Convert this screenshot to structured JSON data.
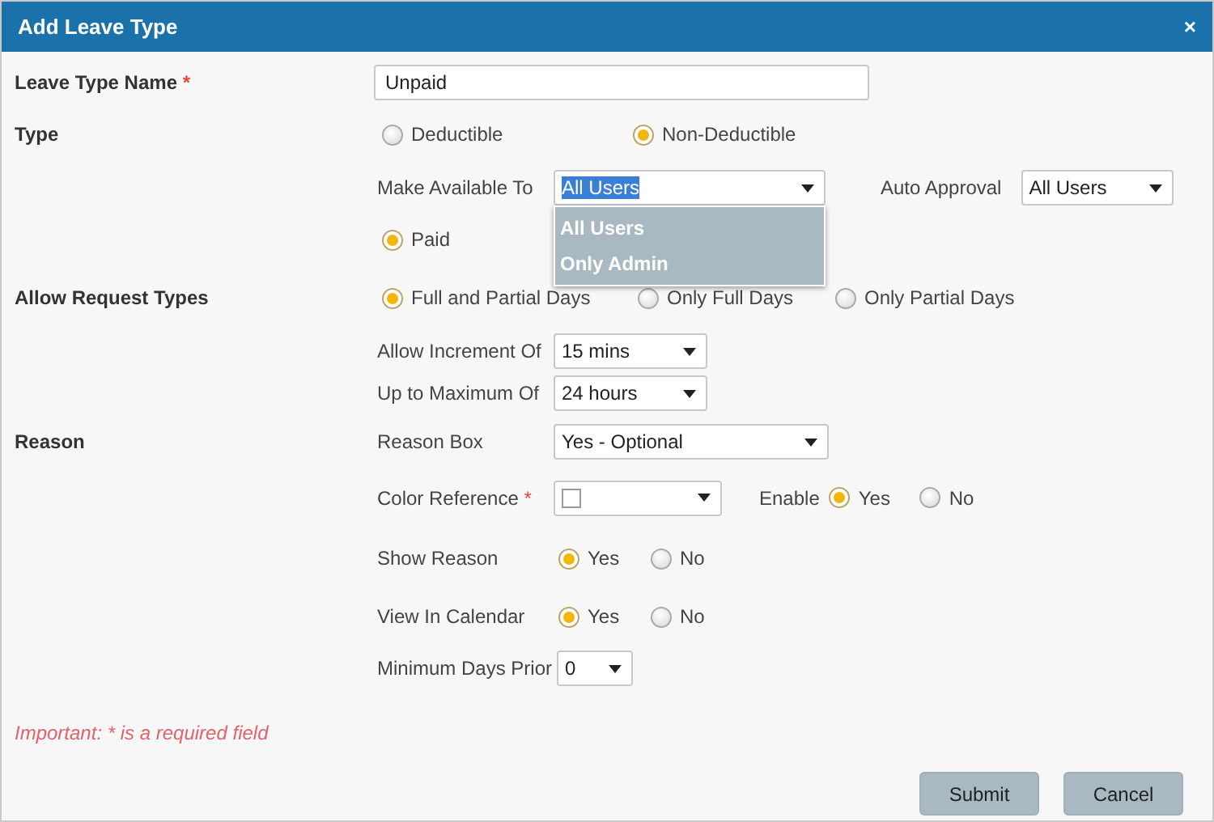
{
  "window": {
    "title": "Add Leave Type",
    "close": "×"
  },
  "leave_type_name": {
    "label": "Leave Type Name",
    "required_mark": "*",
    "value": "Unpaid"
  },
  "type": {
    "label": "Type",
    "options": [
      {
        "label": "Deductible",
        "selected": false
      },
      {
        "label": "Non-Deductible",
        "selected": true
      }
    ]
  },
  "make_available_to": {
    "label": "Make Available To",
    "value": "All Users",
    "expanded": true,
    "options": [
      "All Users",
      "Only Admin"
    ]
  },
  "auto_approval": {
    "label": "Auto Approval",
    "value": "All Users"
  },
  "paid": {
    "label": "Paid",
    "selected": true
  },
  "allow_request_types": {
    "label": "Allow Request Types",
    "options": [
      {
        "label": "Full and Partial Days",
        "selected": true
      },
      {
        "label": "Only Full Days",
        "selected": false
      },
      {
        "label": "Only Partial Days",
        "selected": false
      }
    ]
  },
  "allow_increment_of": {
    "label": "Allow Increment Of",
    "value": "15 mins"
  },
  "up_to_maximum_of": {
    "label": "Up to Maximum Of",
    "value": "24 hours"
  },
  "reason": {
    "label": "Reason"
  },
  "reason_box": {
    "label": "Reason Box",
    "value": "Yes - Optional"
  },
  "color_reference": {
    "label": "Color Reference",
    "required_mark": "*",
    "color": "#ffffff"
  },
  "enable": {
    "label": "Enable",
    "options": [
      {
        "label": "Yes",
        "selected": true
      },
      {
        "label": "No",
        "selected": false
      }
    ]
  },
  "show_reason": {
    "label": "Show Reason",
    "options": [
      {
        "label": "Yes",
        "selected": true
      },
      {
        "label": "No",
        "selected": false
      }
    ]
  },
  "view_in_calendar": {
    "label": "View In Calendar",
    "options": [
      {
        "label": "Yes",
        "selected": true
      },
      {
        "label": "No",
        "selected": false
      }
    ]
  },
  "minimum_days_prior": {
    "label": "Minimum Days Prior",
    "value": "0"
  },
  "note": "Important: * is a required field",
  "buttons": [
    "Submit",
    "Cancel"
  ]
}
